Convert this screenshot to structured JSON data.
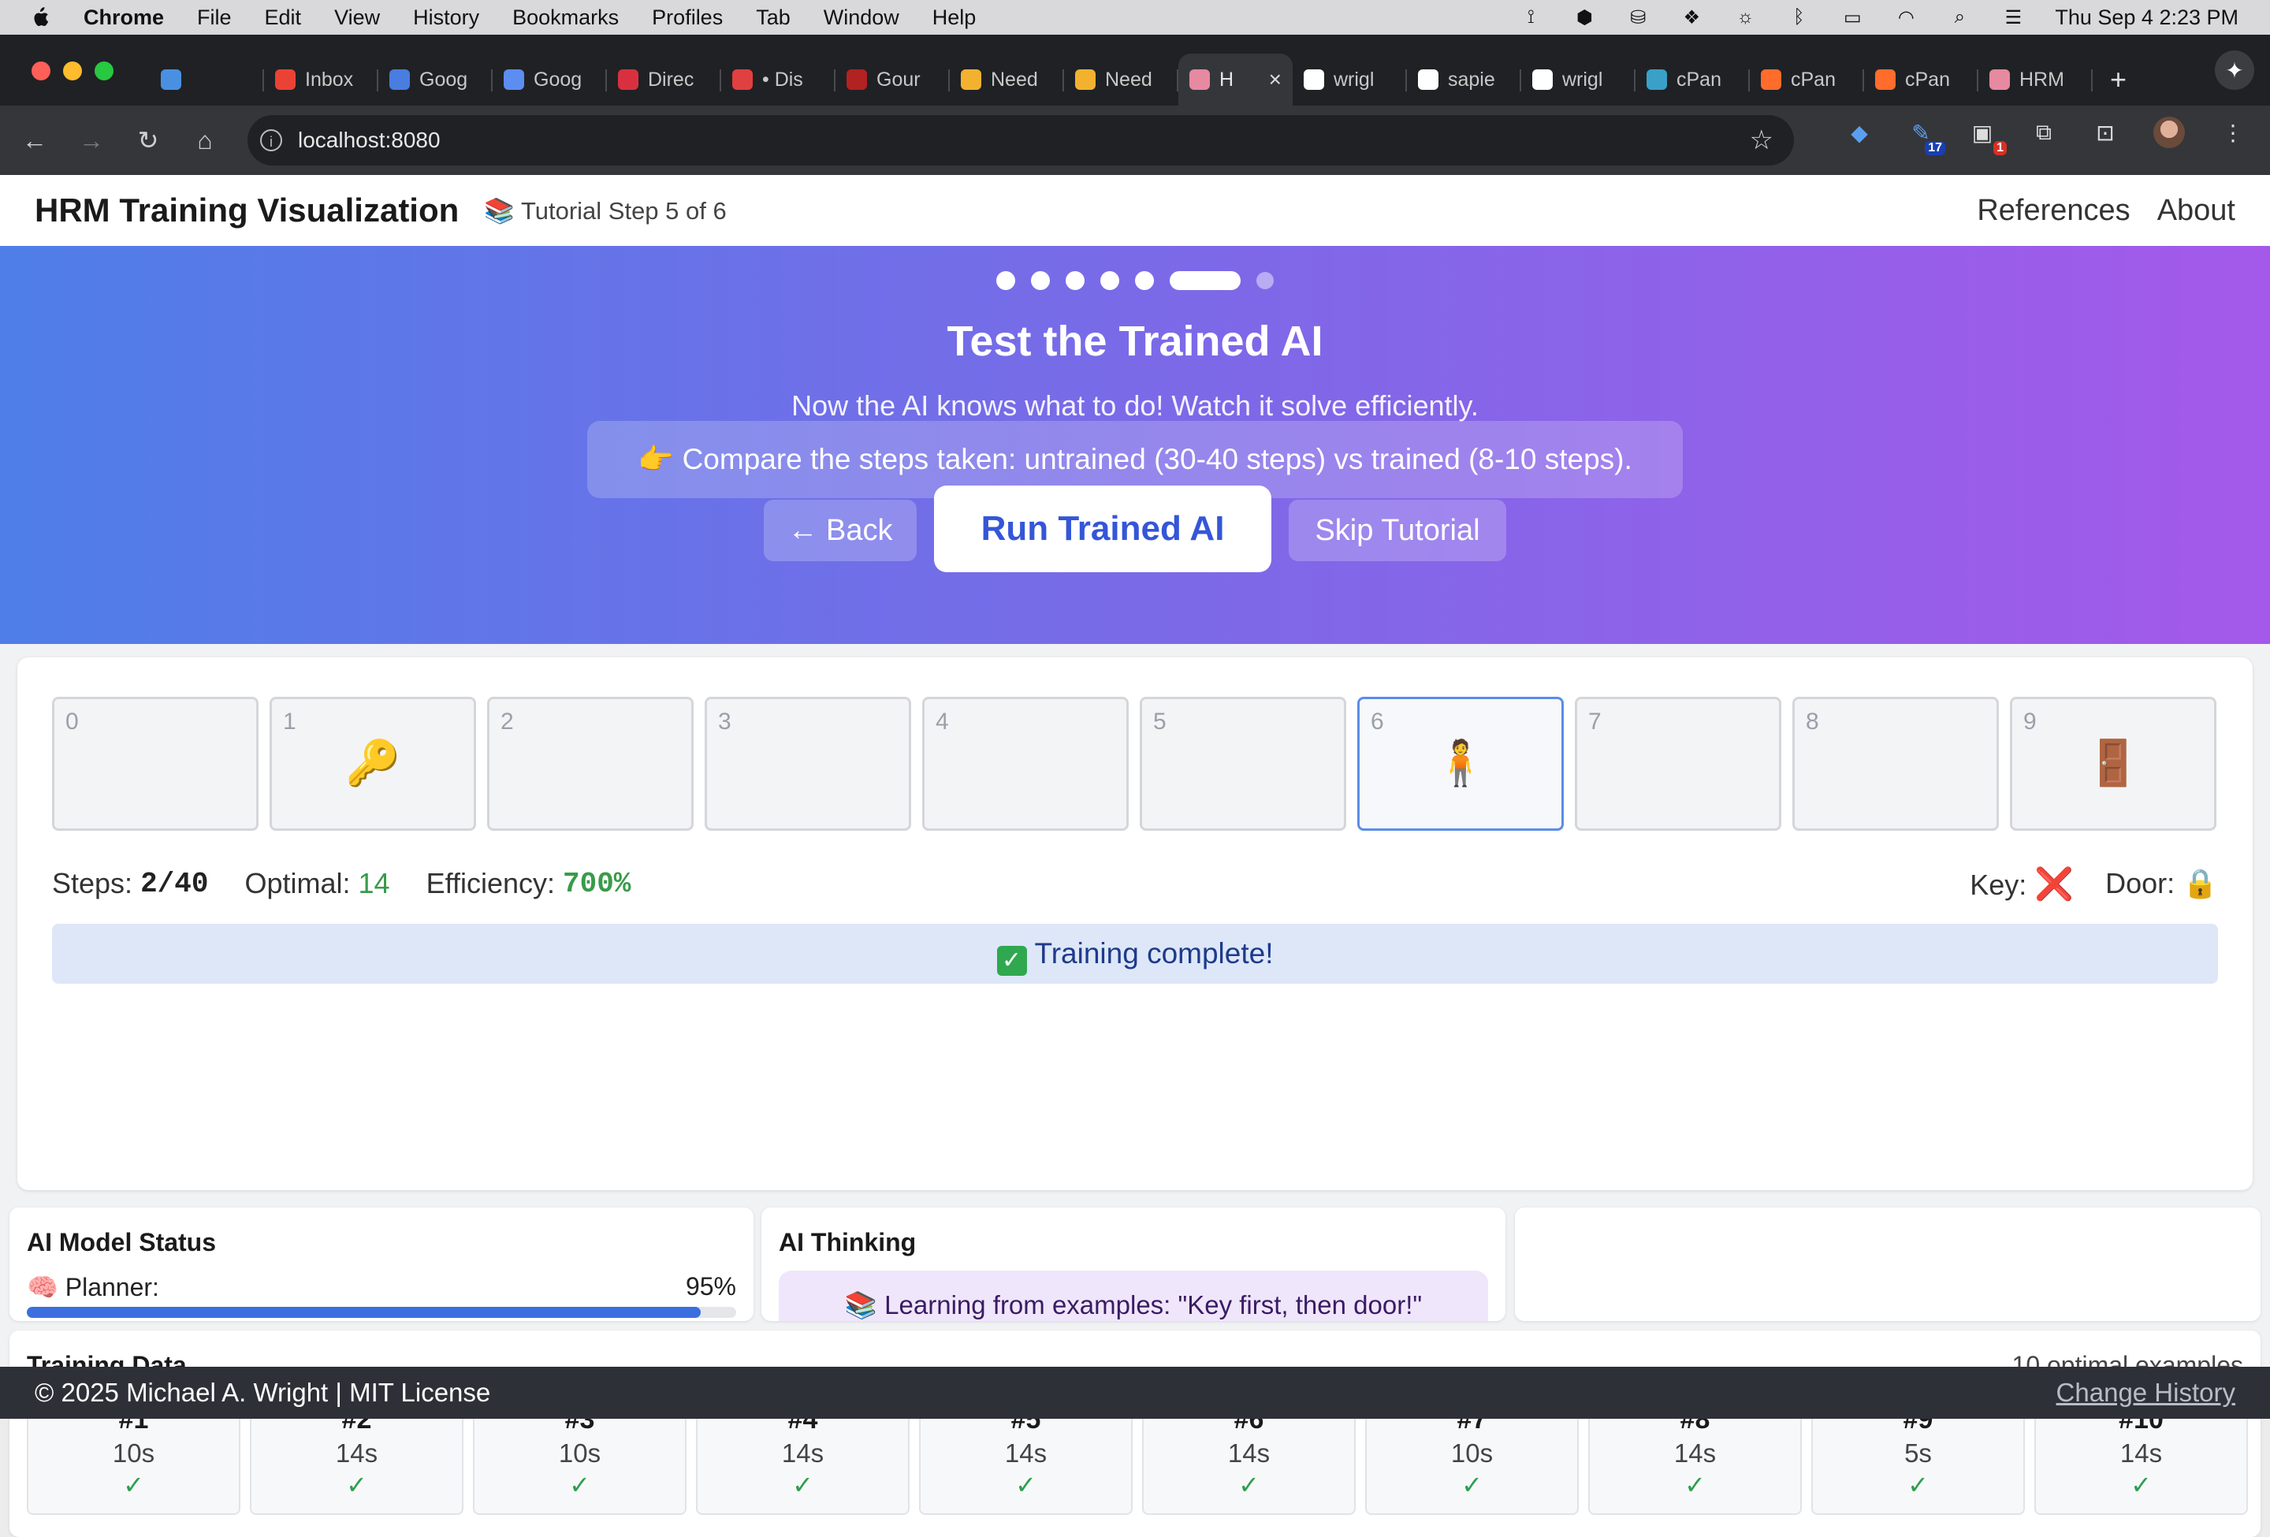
{
  "menubar": {
    "app": "Chrome",
    "items": [
      "File",
      "Edit",
      "View",
      "History",
      "Bookmarks",
      "Profiles",
      "Tab",
      "Window",
      "Help"
    ],
    "datetime": "Thu Sep 4  2:23 PM"
  },
  "browser": {
    "tabs": [
      {
        "label": "",
        "icon": "gem-icon",
        "color": "#4a90e2"
      },
      {
        "label": "Inbox",
        "icon": "gmail-icon",
        "color": "#ea4335"
      },
      {
        "label": "Goog",
        "icon": "chat-icon",
        "color": "#4a7de0"
      },
      {
        "label": "Goog",
        "icon": "gemini-icon",
        "color": "#5b8ef0"
      },
      {
        "label": "Direc",
        "icon": "m-icon",
        "color": "#d93040"
      },
      {
        "label": "• Dis",
        "icon": "disc-icon",
        "color": "#e04040"
      },
      {
        "label": "Gour",
        "icon": "db-icon",
        "color": "#b22222"
      },
      {
        "label": "Need",
        "icon": "sparkle-icon",
        "color": "#f2b230"
      },
      {
        "label": "Need",
        "icon": "sparkle-icon",
        "color": "#f2b230"
      },
      {
        "label": "H",
        "icon": "brain-icon",
        "color": "#e58aa0",
        "active": true
      },
      {
        "label": "wrigl",
        "icon": "github-icon",
        "color": "#ffffff"
      },
      {
        "label": "sapie",
        "icon": "github-icon",
        "color": "#ffffff"
      },
      {
        "label": "wrigl",
        "icon": "github-icon",
        "color": "#ffffff"
      },
      {
        "label": "cPan",
        "icon": "cpan-icon",
        "color": "#3aa0c8"
      },
      {
        "label": "cPan",
        "icon": "cpanel-icon",
        "color": "#ff6c2c"
      },
      {
        "label": "cPan",
        "icon": "cpanel-icon",
        "color": "#ff6c2c"
      },
      {
        "label": "HRM",
        "icon": "brain-icon",
        "color": "#e58aa0"
      }
    ],
    "url": "localhost:8080",
    "ext_badges": [
      "17",
      "1"
    ]
  },
  "header": {
    "title": "HRM Training Visualization",
    "step": "📚 Tutorial Step 5 of 6",
    "links": [
      "References",
      "About"
    ]
  },
  "tutorial": {
    "total_steps": 7,
    "current_step": 6,
    "title": "Test the Trained AI",
    "subtitle": "Now the AI knows what to do! Watch it solve efficiently.",
    "hint": "👉 Compare the steps taken: untrained (30-40 steps) vs trained (8-10 steps).",
    "back_label": "← Back",
    "run_label": "Run Trained AI",
    "skip_label": "Skip Tutorial"
  },
  "grid": {
    "cells": [
      {
        "num": "0",
        "item": ""
      },
      {
        "num": "1",
        "item": "🔑"
      },
      {
        "num": "2",
        "item": ""
      },
      {
        "num": "3",
        "item": ""
      },
      {
        "num": "4",
        "item": ""
      },
      {
        "num": "5",
        "item": ""
      },
      {
        "num": "6",
        "item": "🧍",
        "agent": true
      },
      {
        "num": "7",
        "item": ""
      },
      {
        "num": "8",
        "item": ""
      },
      {
        "num": "9",
        "item": "🚪"
      }
    ]
  },
  "stats": {
    "steps_label": "Steps:",
    "steps_value": "2/40",
    "optimal_label": "Optimal:",
    "optimal_value": "14",
    "efficiency_label": "Efficiency:",
    "efficiency_value": "700%",
    "key_label": "Key:",
    "key_value": "❌",
    "door_label": "Door:",
    "door_value": "🔒"
  },
  "status": {
    "icon": "✓",
    "text": "Training complete!"
  },
  "model": {
    "title": "AI Model Status",
    "planner_label": "🧠 Planner:",
    "planner_pct": "95%",
    "planner_value": 0.95
  },
  "thinking": {
    "title": "AI Thinking",
    "text": "📚 Learning from examples: \"Key first, then door!\""
  },
  "training": {
    "title": "Training Data",
    "count": "10 optimal examples",
    "examples": [
      {
        "n": "#1",
        "t": "10s",
        "c": "✓"
      },
      {
        "n": "#2",
        "t": "14s",
        "c": "✓"
      },
      {
        "n": "#3",
        "t": "10s",
        "c": "✓"
      },
      {
        "n": "#4",
        "t": "14s",
        "c": "✓"
      },
      {
        "n": "#5",
        "t": "14s",
        "c": "✓"
      },
      {
        "n": "#6",
        "t": "14s",
        "c": "✓"
      },
      {
        "n": "#7",
        "t": "10s",
        "c": "✓"
      },
      {
        "n": "#8",
        "t": "14s",
        "c": "✓"
      },
      {
        "n": "#9",
        "t": "5s",
        "c": "✓"
      },
      {
        "n": "#10",
        "t": "14s",
        "c": "✓"
      }
    ]
  },
  "footer": {
    "copyright": "© 2025 Michael A. Wright | MIT License",
    "history": "Change History"
  }
}
